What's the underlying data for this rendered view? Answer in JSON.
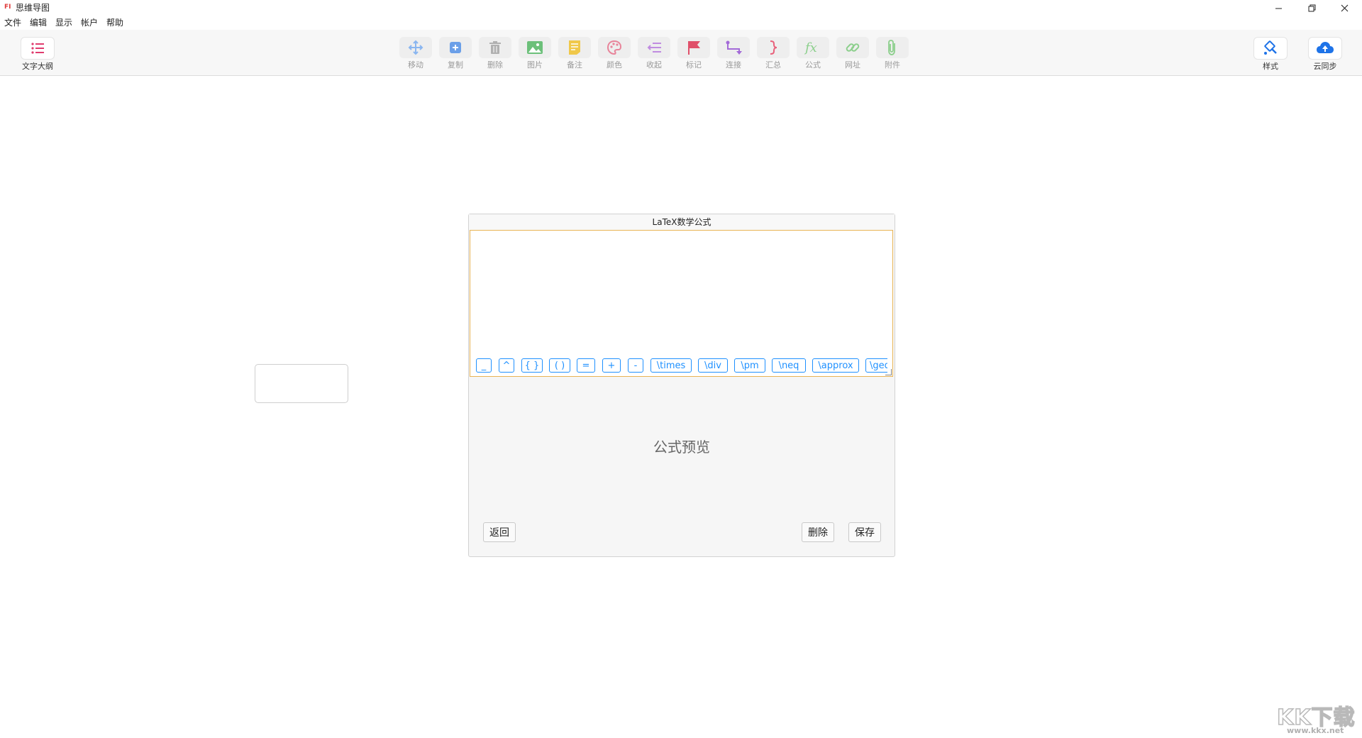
{
  "titlebar": {
    "app_icon_text": "FI",
    "title": "思维导图",
    "minimize_icon": "minimize-icon",
    "restore_icon": "restore-icon",
    "close_icon": "close-icon"
  },
  "menubar": {
    "items": [
      "文件",
      "编辑",
      "显示",
      "帐户",
      "帮助"
    ]
  },
  "toolbar": {
    "outline": {
      "label": "文字大纲",
      "icon": "list-icon",
      "color": "#e03c6e"
    },
    "tools": [
      {
        "label": "移动",
        "icon": "move-icon",
        "color": "#8ab6f0"
      },
      {
        "label": "复制",
        "icon": "copy-icon",
        "color": "#6b9fe8"
      },
      {
        "label": "删除",
        "icon": "trash-icon",
        "color": "#b0b0b0"
      },
      {
        "label": "图片",
        "icon": "image-icon",
        "color": "#6cc07a"
      },
      {
        "label": "备注",
        "icon": "note-icon",
        "color": "#f0c84a"
      },
      {
        "label": "颜色",
        "icon": "palette-icon",
        "color": "#e8849a"
      },
      {
        "label": "收起",
        "icon": "collapse-icon",
        "color": "#c08ce0"
      },
      {
        "label": "标记",
        "icon": "flag-icon",
        "color": "#e0506a"
      },
      {
        "label": "连接",
        "icon": "connect-icon",
        "color": "#a36ad8"
      },
      {
        "label": "汇总",
        "icon": "brace-icon",
        "color": "#e8607a"
      },
      {
        "label": "公式",
        "icon": "fx-icon",
        "color": "#8ccf8c"
      },
      {
        "label": "网址",
        "icon": "link-icon",
        "color": "#8ccf8c"
      },
      {
        "label": "附件",
        "icon": "paperclip-icon",
        "color": "#8ccf8c"
      }
    ],
    "style": {
      "label": "样式",
      "icon": "paint-icon",
      "color": "#1e73e8"
    },
    "sync": {
      "label": "云同步",
      "icon": "cloud-upload-icon",
      "color": "#1e73e8"
    }
  },
  "dialog": {
    "title": "LaTeX数学公式",
    "editor_value": "",
    "snippets": [
      "_",
      "^",
      "{ }",
      "( )",
      "=",
      "+",
      "-",
      "\\times",
      "\\div",
      "\\pm",
      "\\neq",
      "\\approx",
      "\\geq"
    ],
    "preview_text": "公式预览",
    "back_label": "返回",
    "delete_label": "删除",
    "save_label": "保存",
    "accent": "#1e90ff",
    "editor_border": "#e8b455"
  },
  "watermark": {
    "text": "KK下载",
    "url": "www.kkx.net"
  }
}
